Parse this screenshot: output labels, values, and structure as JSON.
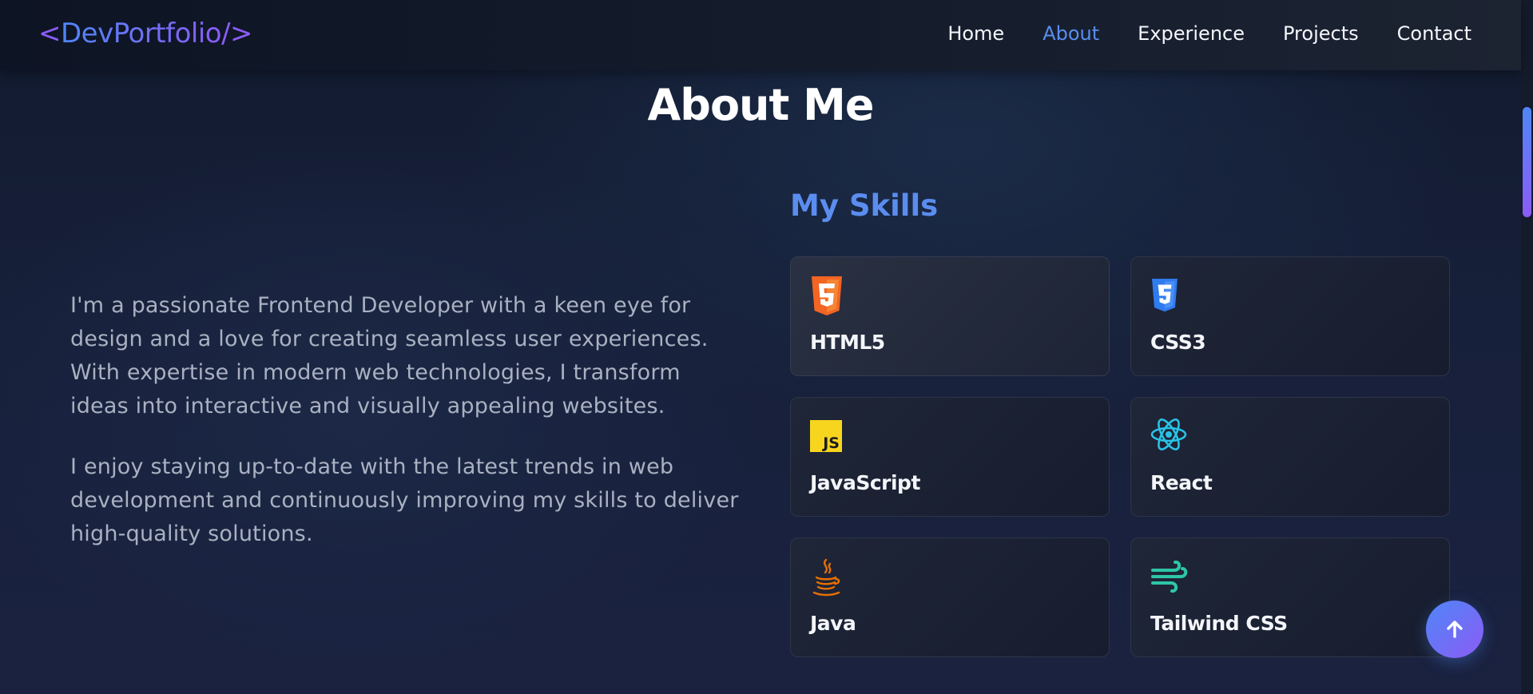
{
  "nav": {
    "logo": {
      "open": "<",
      "name": "DevPortfolio",
      "close": "/>"
    },
    "links": [
      {
        "label": "Home",
        "active": false
      },
      {
        "label": "About",
        "active": true
      },
      {
        "label": "Experience",
        "active": false
      },
      {
        "label": "Projects",
        "active": false
      },
      {
        "label": "Contact",
        "active": false
      }
    ]
  },
  "about": {
    "title": "About Me",
    "paragraphs": [
      "I'm a passionate Frontend Developer with a keen eye for design and a love for creating seamless user experiences. With expertise in modern web technologies, I transform ideas into interactive and visually appealing websites.",
      "I enjoy staying up-to-date with the latest trends in web development and continuously improving my skills to deliver high-quality solutions."
    ]
  },
  "skills": {
    "title": "My Skills",
    "items": [
      {
        "name": "HTML5",
        "icon": "html5-icon",
        "color": "#f26522"
      },
      {
        "name": "CSS3",
        "icon": "css3-icon",
        "color": "#2f7bf0"
      },
      {
        "name": "JavaScript",
        "icon": "javascript-icon",
        "color": "#f7d51e"
      },
      {
        "name": "React",
        "icon": "react-icon",
        "color": "#29c3e6"
      },
      {
        "name": "Java",
        "icon": "java-icon",
        "color": "#e76f00"
      },
      {
        "name": "Tailwind CSS",
        "icon": "tailwind-icon",
        "color": "#2dc6a6"
      }
    ]
  },
  "colors": {
    "accent": "#5b8def",
    "accent_purple": "#8b5cf6",
    "text_muted": "#a9b1c1"
  },
  "scroll_to_top": {
    "icon": "arrow-up-icon"
  }
}
